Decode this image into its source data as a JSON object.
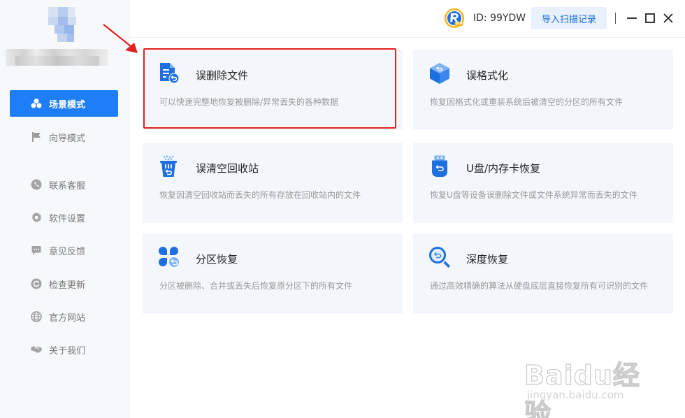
{
  "user": {
    "id_text": "ID: 99YDW"
  },
  "header": {
    "import_label": "导入扫描记录"
  },
  "sidebar": {
    "items": [
      {
        "label": "场景模式",
        "icon": "scene-icon",
        "active": true
      },
      {
        "label": "向导模式",
        "icon": "flag-icon",
        "active": false
      },
      {
        "label": "联系客服",
        "icon": "phone-icon",
        "active": false
      },
      {
        "label": "软件设置",
        "icon": "gear-icon",
        "active": false
      },
      {
        "label": "意见反馈",
        "icon": "feedback-icon",
        "active": false
      },
      {
        "label": "检查更新",
        "icon": "refresh-icon",
        "active": false
      },
      {
        "label": "官方网站",
        "icon": "globe-icon",
        "active": false
      },
      {
        "label": "关于我们",
        "icon": "handshake-icon",
        "active": false
      }
    ]
  },
  "cards": [
    {
      "title": "误删除文件",
      "desc": "可以快速完整地恢复被删除/异常丢失的各种数据",
      "icon": "document-restore-icon"
    },
    {
      "title": "误格式化",
      "desc": "恢复因格式化或重装系统后被清空的分区的所有文件",
      "icon": "cube-restore-icon"
    },
    {
      "title": "误清空回收站",
      "desc": "恢复因清空回收站而丢失的所有存放在回收站内的文件",
      "icon": "recycle-bin-icon"
    },
    {
      "title": "U盘/内存卡恢复",
      "desc": "恢复U盘等设备误删除文件或文件系统异常而丢失的文件",
      "icon": "usb-drive-icon"
    },
    {
      "title": "分区恢复",
      "desc": "分区被删除、合并或丢失后恢复原分区下的所有文件",
      "icon": "partition-icon"
    },
    {
      "title": "深度恢复",
      "desc": "通过高效精确的算法从硬盘底层直接恢复所有可识别的文件",
      "icon": "deep-search-icon"
    }
  ],
  "watermark": {
    "main": "Baidu经验",
    "sub": "jingyan.baidu.com"
  },
  "colors": {
    "accent": "#1e7ef7",
    "highlight": "#e42121",
    "card_bg": "#f3f6fb"
  }
}
